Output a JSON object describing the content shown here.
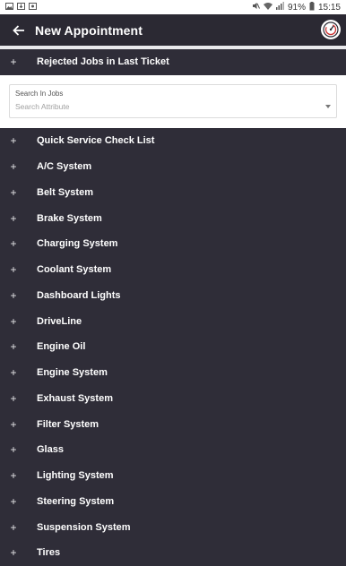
{
  "status_bar": {
    "battery": "91%",
    "time": "15:15"
  },
  "app_bar": {
    "title": "New Appointment"
  },
  "rejected": {
    "label": "Rejected Jobs in Last Ticket",
    "expand": "+"
  },
  "search": {
    "label": "Search In Jobs",
    "placeholder": "Search Attribute"
  },
  "categories": [
    {
      "label": "Quick Service Check List",
      "expand": "+"
    },
    {
      "label": "A/C System",
      "expand": "+"
    },
    {
      "label": "Belt System",
      "expand": "+"
    },
    {
      "label": "Brake System",
      "expand": "+"
    },
    {
      "label": "Charging System",
      "expand": "+"
    },
    {
      "label": "Coolant System",
      "expand": "+"
    },
    {
      "label": "Dashboard Lights",
      "expand": "+"
    },
    {
      "label": "DriveLine",
      "expand": "+"
    },
    {
      "label": "Engine Oil",
      "expand": "+"
    },
    {
      "label": "Engine System",
      "expand": "+"
    },
    {
      "label": "Exhaust System",
      "expand": "+"
    },
    {
      "label": "Filter System",
      "expand": "+"
    },
    {
      "label": "Glass",
      "expand": "+"
    },
    {
      "label": "Lighting System",
      "expand": "+"
    },
    {
      "label": "Steering System",
      "expand": "+"
    },
    {
      "label": "Suspension System",
      "expand": "+"
    },
    {
      "label": "Tires",
      "expand": "+"
    }
  ]
}
